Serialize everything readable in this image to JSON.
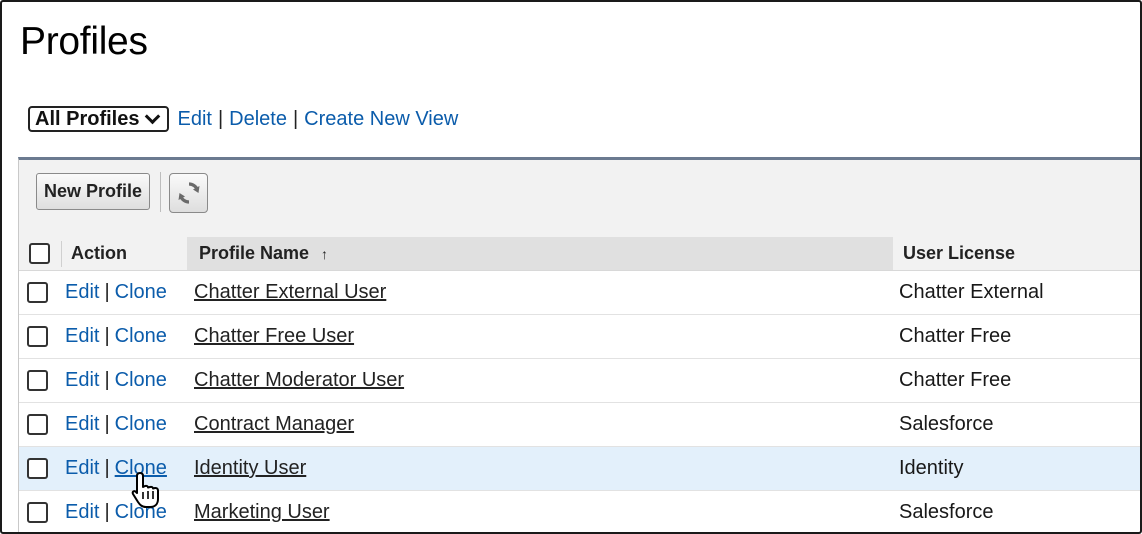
{
  "page": {
    "title": "Profiles"
  },
  "view_bar": {
    "selected_view": "All Profiles",
    "edit": "Edit",
    "delete": "Delete",
    "create": "Create New View",
    "separator": "|"
  },
  "toolbar": {
    "new_profile": "New Profile",
    "refresh_icon": "refresh-icon"
  },
  "table": {
    "headers": {
      "action": "Action",
      "profile_name": "Profile Name",
      "sort_arrow": "↑",
      "user_license": "User License"
    },
    "action_edit": "Edit",
    "action_clone": "Clone",
    "separator": "|",
    "rows": [
      {
        "name": "Chatter External User",
        "license": "Chatter External"
      },
      {
        "name": "Chatter Free User",
        "license": "Chatter Free"
      },
      {
        "name": "Chatter Moderator User",
        "license": "Chatter Free"
      },
      {
        "name": "Contract Manager",
        "license": "Salesforce"
      },
      {
        "name": "Identity User",
        "license": "Identity"
      },
      {
        "name": "Marketing User",
        "license": "Salesforce"
      }
    ]
  },
  "colors": {
    "link": "#0b5cab",
    "highlight_row": "#e3f0fb",
    "panel_border": "#6b7a90"
  },
  "pointer": {
    "icon": "hand-pointer-icon"
  }
}
